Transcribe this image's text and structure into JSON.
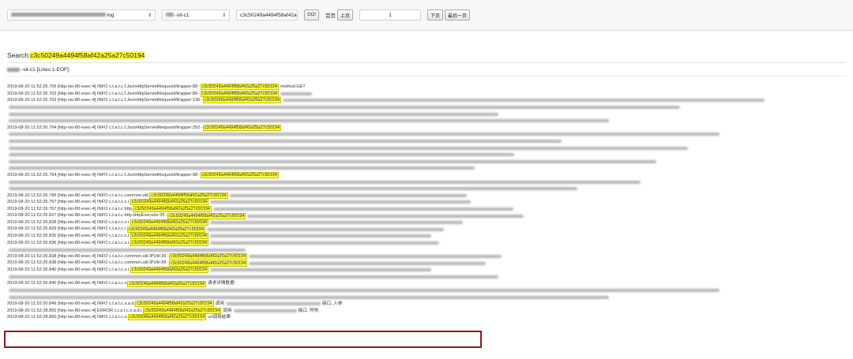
{
  "toolbar": {
    "app_select": {
      "value": "log",
      "arrow": "⇕"
    },
    "env_select": {
      "value": "-sit-c1",
      "arrow": "⇕"
    },
    "search_input": {
      "value": "c3c50249a4494f58af42a"
    },
    "go_label": "GO!",
    "first_page_label": "首页",
    "prev_page_label": "上页",
    "page_number": "1",
    "next_page_label": "下页",
    "last_page_label": "最后一页"
  },
  "search": {
    "label": "Search:",
    "term": "c3c50249a4494f58af42a25a27c50194"
  },
  "file": {
    "name": "-sit-c1",
    "range": "[Lines:1-EOF]:"
  },
  "trace_id": "c3c50249a4494f58af42a25a27c50194",
  "log_rows": [
    {
      "type": "log",
      "prefix": "2019-08-20 11:52:26.706 [http-nio-80-exec-4] INFO c.t.a.t.c.f.JsonHttpServletRequestWrapper:88 - ",
      "suffix": "method:GET",
      "blur": 0
    },
    {
      "type": "log",
      "prefix": "2019-08-20 11:52:26.763 [http-nio-80-exec-4] INFO c.t.a.t.c.f.JsonHttpServletRequestWrapper:89 - ",
      "suffix": "",
      "blur": 40
    },
    {
      "type": "log",
      "prefix": "2019-08-20 11:52:26.763 [http-nio-80-exec-4] INFO c.t.a.t.c.f.JsonHttpServletRequestWrapper:136 - ",
      "suffix": "",
      "blur": 610
    },
    {
      "type": "blur",
      "width": 850
    },
    {
      "type": "blur",
      "width": 620
    },
    {
      "type": "blur",
      "width": 760
    },
    {
      "type": "log",
      "prefix": "2019-08-20 11:52:26.764 [http-nio-80-exec-4] INFO c.t.a.t.c.f.JsonHttpServletRequestWrapper:252 - ",
      "suffix": "",
      "blur": 0
    },
    {
      "type": "blur",
      "width": 900
    },
    {
      "type": "blur",
      "width": 700
    },
    {
      "type": "blur",
      "width": 860
    },
    {
      "type": "blur",
      "width": 640
    },
    {
      "type": "blur",
      "width": 820
    },
    {
      "type": "blur",
      "width": 590
    },
    {
      "type": "log",
      "prefix": "2019-08-20 11:52:26.764 [http-nio-80-exec-4] INFO c.t.a.t.c.f.JsonHttpServletRequestWrapper:98 - ",
      "suffix": "",
      "blur": 0
    },
    {
      "type": "blur",
      "width": 800
    },
    {
      "type": "blur",
      "width": 720
    },
    {
      "type": "log",
      "prefix": "2019-08-20 11:52:26.766 [http-nio-80-exec-4] INFO c.t.a.t.c.common.util.",
      "suffix": "",
      "blur": 300
    },
    {
      "type": "log",
      "prefix": "2019-08-20 11:52:26.767 [http-nio-80-exec-4] INFO c.t.a.t.c.s.i.",
      "suffix": "",
      "blur": 330
    },
    {
      "type": "log",
      "prefix": "2019-08-20 11:52:26.767 [http-nio-80-exec-4] INFO c.t.a.t.c.http.",
      "suffix": "",
      "blur": 380
    },
    {
      "type": "log",
      "prefix": "2019-08-20 11:52:26.827 [http-nio-80-exec-4] INFO c.t.a.t.c.http.HttpExecutor:35 - ",
      "suffix": "",
      "blur": 350
    },
    {
      "type": "log",
      "prefix": "2019-08-20 11:52:26.828 [http-nio-80-exec-4] INFO c.t.a.t.c.s.i.",
      "suffix": "",
      "blur": 320
    },
    {
      "type": "log",
      "prefix": "2019-08-20 11:52:26.829 [http-nio-80-exec-4] INFO c.t.a.t.c.r.",
      "suffix": "",
      "blur": 300
    },
    {
      "type": "log",
      "prefix": "2019-08-20 11:52:26.835 [http-nio-80-exec-4] INFO c.t.a.t.c.s.i.",
      "suffix": "",
      "blur": 280
    },
    {
      "type": "log",
      "prefix": "2019-08-20 11:52:26.836 [http-nio-80-exec-4] INFO c.t.a.t.c.s.i.",
      "suffix": "",
      "blur": 290
    },
    {
      "type": "blur",
      "width": 300
    },
    {
      "type": "log",
      "prefix": "2019-08-20 11:52:26.838 [http-nio-80-exec-4] INFO c.t.a.t.c.common.util.IPUtil:39 - ",
      "suffix": "",
      "blur": 320
    },
    {
      "type": "log",
      "prefix": "2019-08-20 11:52:26.838 [http-nio-80-exec-4] INFO c.t.a.t.c.common.util.IPUtil:39 - ",
      "suffix": "",
      "blur": 300
    },
    {
      "type": "log",
      "prefix": "2019-08-20 11:52:26.840 [http-nio-80-exec-4] INFO c.t.a.t.c.s.i.",
      "suffix": "",
      "blur": 280
    },
    {
      "type": "blur",
      "width": 620
    },
    {
      "type": "log",
      "prefix": "2019-08-20 11:52:26.840 [http-nio-80-exec-4] INFO c.t.a.t.c.v.",
      "suffix": "请求详情数据:",
      "blur": 0
    },
    {
      "type": "blur",
      "width": 900
    },
    {
      "type": "blur",
      "width": 760
    },
    {
      "type": "log",
      "prefix": "2019-08-20 11:52:26.849 [http-nio-80-exec-4] INFO c.t.a.t.c.s.a.d.",
      "suffix": "调用",
      "blur": 120,
      "tail": "接口, 入参:"
    },
    {
      "type": "log",
      "prefix": "2019-08-20 11:52:28.855 [http-nio-80-exec-4] ERROR c.t.a.t.c.s.a.d.i.",
      "suffix": "调用",
      "blur": 80,
      "tail": "接口, 异常:"
    },
    {
      "type": "log",
      "prefix": "2019-08-20 11:52:28.860 [http-nio-80-exec-4] INFO c.t.a.t.c.s.",
      "suffix": "url调用结果",
      "blur": 0
    }
  ]
}
